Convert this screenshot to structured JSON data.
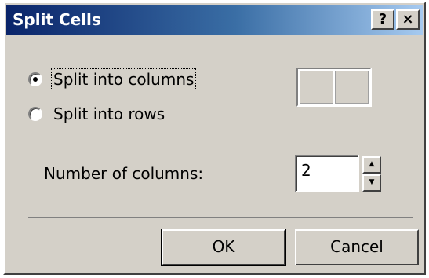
{
  "dialog": {
    "title": "Split Cells",
    "help_glyph": "?",
    "close_glyph": "×"
  },
  "options": {
    "split_columns_label": "Split into columns",
    "split_rows_label": "Split into rows",
    "selected": "columns"
  },
  "preview": {
    "columns": 2
  },
  "number": {
    "label": "Number of columns:",
    "value": "2",
    "up_glyph": "▲",
    "down_glyph": "▼"
  },
  "buttons": {
    "ok_label": "OK",
    "cancel_label": "Cancel"
  }
}
